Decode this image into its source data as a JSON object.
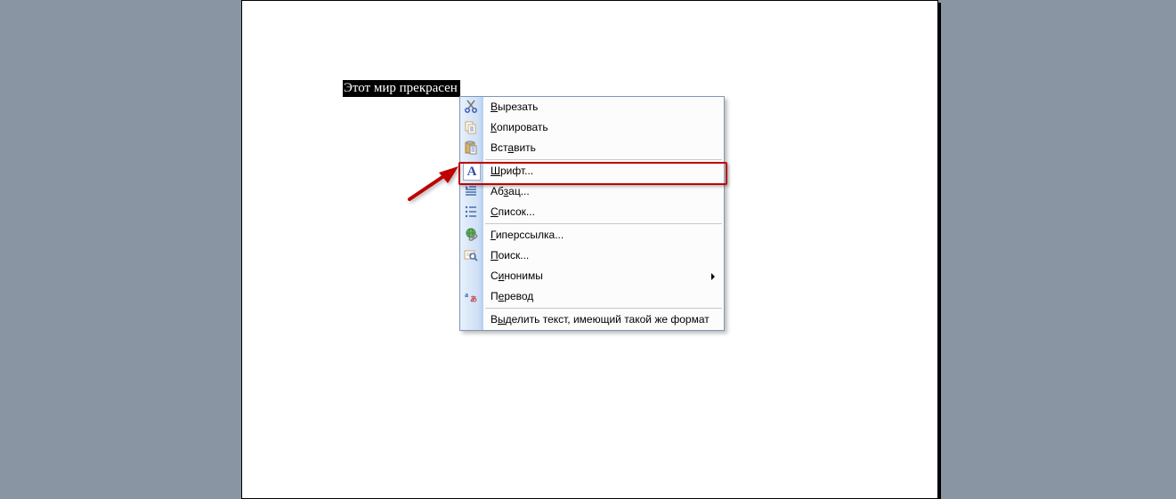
{
  "document": {
    "selected_text": "Этот мир прекрасен"
  },
  "context_menu": {
    "items": [
      {
        "icon": "cut-icon",
        "label_pre": "",
        "label_u": "В",
        "label_post": "ырезать",
        "submenu": false
      },
      {
        "icon": "copy-icon",
        "label_pre": "",
        "label_u": "К",
        "label_post": "опировать",
        "submenu": false
      },
      {
        "icon": "paste-icon",
        "label_pre": "Вст",
        "label_u": "а",
        "label_post": "вить",
        "submenu": false
      },
      {
        "sep": true
      },
      {
        "icon": "font-icon",
        "label_pre": "",
        "label_u": "Ш",
        "label_post": "рифт...",
        "submenu": false,
        "highlighted": true
      },
      {
        "icon": "paragraph-icon",
        "label_pre": "Аб",
        "label_u": "з",
        "label_post": "ац...",
        "submenu": false
      },
      {
        "icon": "list-icon",
        "label_pre": "",
        "label_u": "С",
        "label_post": "писок...",
        "submenu": false
      },
      {
        "sep": true
      },
      {
        "icon": "hyperlink-icon",
        "label_pre": "",
        "label_u": "Г",
        "label_post": "иперссылка...",
        "submenu": false
      },
      {
        "icon": "search-icon",
        "label_pre": "",
        "label_u": "П",
        "label_post": "оиск...",
        "submenu": false
      },
      {
        "icon": "",
        "label_pre": "С",
        "label_u": "и",
        "label_post": "нонимы",
        "submenu": true
      },
      {
        "icon": "translate-icon",
        "label_pre": "П",
        "label_u": "е",
        "label_post": "ревод",
        "submenu": false
      },
      {
        "sep": true
      },
      {
        "icon": "",
        "label_pre": "В",
        "label_u": "ы",
        "label_post": "делить текст, имеющий такой же формат",
        "submenu": false
      }
    ]
  }
}
